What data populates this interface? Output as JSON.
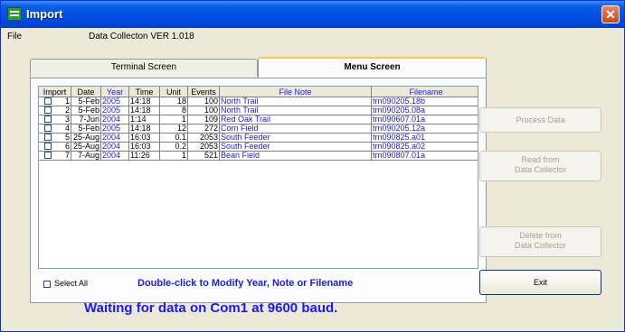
{
  "window": {
    "title": "Import",
    "close_label": "✕"
  },
  "menu": {
    "file": "File",
    "version": "Data Collecton VER 1.018"
  },
  "tabs": [
    {
      "label": "Terminal Screen",
      "active": false
    },
    {
      "label": "Menu Screen",
      "active": true
    }
  ],
  "table": {
    "headers": [
      "Import",
      "Date",
      "Year",
      "Time",
      "Unit",
      "Events",
      "File Note",
      "Filename"
    ],
    "rows": [
      {
        "idx": "1",
        "date": "5-Feb",
        "year": "2005",
        "time": "14:18",
        "unit": "18",
        "events": "100",
        "note": "North Trail",
        "filename": "trn090205.18b"
      },
      {
        "idx": "2",
        "date": "5-Feb",
        "year": "2005",
        "time": "14:18",
        "unit": "8",
        "events": "100",
        "note": "North Trail",
        "filename": "trn090205.08a"
      },
      {
        "idx": "3",
        "date": "7-Jun",
        "year": "2004",
        "time": "1:14",
        "unit": "1",
        "events": "109",
        "note": "Red Oak Trail",
        "filename": "trn090607.01a"
      },
      {
        "idx": "4",
        "date": "5-Feb",
        "year": "2005",
        "time": "14:18",
        "unit": "12",
        "events": "272",
        "note": "Corn Field",
        "filename": "trn090205.12a"
      },
      {
        "idx": "5",
        "date": "25-Aug",
        "year": "2004",
        "time": "16:03",
        "unit": "0.1",
        "events": "2053",
        "note": "South Feeder",
        "filename": "trn090825.a01"
      },
      {
        "idx": "6",
        "date": "25-Aug",
        "year": "2004",
        "time": "16:03",
        "unit": "0.2",
        "events": "2053",
        "note": "South Feeder",
        "filename": "trn090825.a02"
      },
      {
        "idx": "7",
        "date": "7-Aug",
        "year": "2004",
        "time": "11:26",
        "unit": "1",
        "events": "521",
        "note": "Bean Field",
        "filename": "trn090807.01a"
      }
    ]
  },
  "select_all": "Select All",
  "hint": "Double-click to Modify Year, Note or Filename",
  "buttons": {
    "process": "Process Data",
    "read_line1": "Read from",
    "read_line2": "Data Collector",
    "delete_line1": "Delete from",
    "delete_line2": "Data Collector",
    "exit": "Exit"
  },
  "status": "Waiting for data on Com1 at 9600 baud."
}
